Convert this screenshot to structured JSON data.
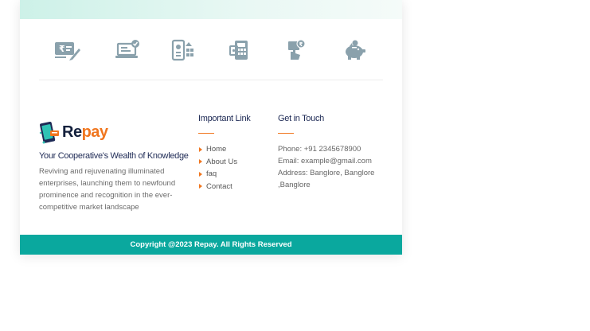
{
  "services": [
    {
      "icon": "rupee-bill-pen-icon"
    },
    {
      "icon": "laptop-check-icon"
    },
    {
      "icon": "mobile-bill-icon"
    },
    {
      "icon": "calculator-card-icon"
    },
    {
      "icon": "hand-coin-icon"
    },
    {
      "icon": "piggy-bank-icon"
    }
  ],
  "brand": {
    "logo_re": "Re",
    "logo_pay": "pay",
    "tagline": "Your Cooperative's Wealth of Knowledge",
    "about": "Reviving and rejuvenating illuminated enterprises, launching them to newfound prominence and recognition in the ever-competitive market landscape"
  },
  "important_links": {
    "title": "Important Link",
    "items": [
      "Home",
      "About Us",
      "faq",
      "Contact"
    ]
  },
  "get_in_touch": {
    "title": "Get in Touch",
    "phone": "Phone: +91 2345678900",
    "email": "Email: example@gmail.com",
    "address": "Address: Banglore, Banglore ,Banglore"
  },
  "copyright": "Copyright @2023 Repay. All Rights Reserved",
  "colors": {
    "accent": "#f0761f",
    "footer_bar": "#0aa89e",
    "heading": "#1e2a55",
    "icon_gray": "#8aa1ac"
  }
}
